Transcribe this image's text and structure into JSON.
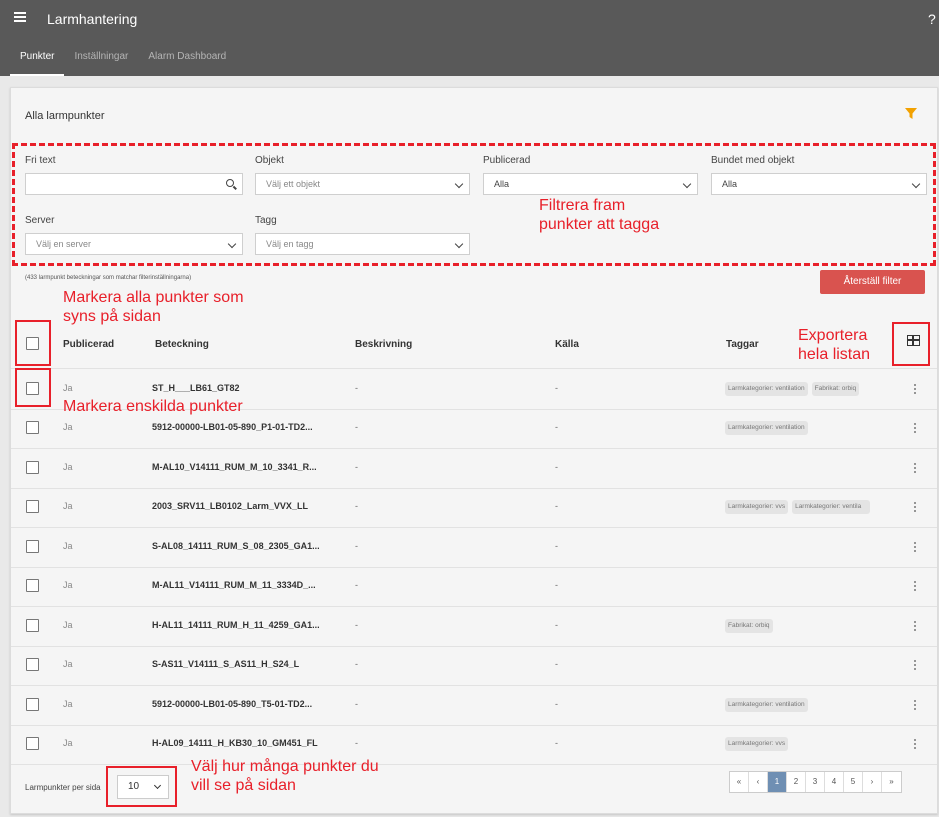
{
  "app": {
    "title": "Larmhantering",
    "help": "?"
  },
  "tabs": [
    {
      "label": "Punkter",
      "active": true
    },
    {
      "label": "Inställningar",
      "active": false
    },
    {
      "label": "Alarm Dashboard",
      "active": false
    }
  ],
  "card": {
    "title": "Alla larmpunkter"
  },
  "filters": {
    "fritext": {
      "label": "Fri text",
      "value": ""
    },
    "objekt": {
      "label": "Objekt",
      "placeholder": "Välj ett objekt"
    },
    "publicerad": {
      "label": "Publicerad",
      "value": "Alla"
    },
    "bundet": {
      "label": "Bundet med objekt",
      "value": "Alla"
    },
    "server": {
      "label": "Server",
      "placeholder": "Välj en server"
    },
    "tagg": {
      "label": "Tagg",
      "placeholder": "Välj en tagg"
    }
  },
  "match_text": "(433 larmpunkt beteckningar som matchar filterinställningarna)",
  "reset_label": "Återställ filter",
  "table": {
    "headers": {
      "publicerad": "Publicerad",
      "beteckning": "Beteckning",
      "beskrivning": "Beskrivning",
      "kalla": "Källa",
      "taggar": "Taggar"
    },
    "rows": [
      {
        "pub": "Ja",
        "bet": "ST_H___LB61_GT82",
        "besk": "-",
        "kalla": "-",
        "tags": [
          "Larmkategorier: ventilation",
          "Fabrikat: orbiq"
        ]
      },
      {
        "pub": "Ja",
        "bet": "5912-00000-LB01-05-890_P1-01-TD2...",
        "besk": "-",
        "kalla": "-",
        "tags": [
          "Larmkategorier: ventilation"
        ]
      },
      {
        "pub": "Ja",
        "bet": "M-AL10_V14111_RUM_M_10_3341_R...",
        "besk": "-",
        "kalla": "-",
        "tags": []
      },
      {
        "pub": "Ja",
        "bet": "2003_SRV11_LB0102_Larm_VVX_LL",
        "besk": "-",
        "kalla": "-",
        "tags": [
          "Larmkategorier: vvs",
          "Larmkategorier: ventila"
        ]
      },
      {
        "pub": "Ja",
        "bet": "S-AL08_14111_RUM_S_08_2305_GA1...",
        "besk": "-",
        "kalla": "-",
        "tags": []
      },
      {
        "pub": "Ja",
        "bet": "M-AL11_V14111_RUM_M_11_3334D_...",
        "besk": "-",
        "kalla": "-",
        "tags": []
      },
      {
        "pub": "Ja",
        "bet": "H-AL11_14111_RUM_H_11_4259_GA1...",
        "besk": "-",
        "kalla": "-",
        "tags": [
          "Fabrikat: orbiq"
        ]
      },
      {
        "pub": "Ja",
        "bet": "S-AS11_V14111_S_AS11_H_S24_L",
        "besk": "-",
        "kalla": "-",
        "tags": []
      },
      {
        "pub": "Ja",
        "bet": "5912-00000-LB01-05-890_T5-01-TD2...",
        "besk": "-",
        "kalla": "-",
        "tags": [
          "Larmkategorier: ventilation"
        ]
      },
      {
        "pub": "Ja",
        "bet": "H-AL09_14111_H_KB30_10_GM451_FL",
        "besk": "-",
        "kalla": "-",
        "tags": [
          "Larmkategorier: vvs"
        ]
      }
    ]
  },
  "footer": {
    "per_page_label": "Larmpunkter per sida",
    "per_page_value": "10",
    "pages": [
      "«",
      "‹",
      "1",
      "2",
      "3",
      "4",
      "5",
      "›",
      "»"
    ],
    "active_page": "1"
  },
  "annotations": {
    "filter": [
      "Filtrera fram",
      "punkter att tagga"
    ],
    "select_all": [
      "Markera alla punkter som",
      "syns på sidan"
    ],
    "export": [
      "Exportera",
      "hela listan"
    ],
    "select_single": "Markera enskilda punkter",
    "per_page": [
      "Välj hur många punkter du",
      "vill se på sidan"
    ]
  },
  "colors": {
    "appbar": "#595959",
    "reset": "#d9534f",
    "annotation": "#e8202a",
    "active_page": "#6f8fb3"
  }
}
